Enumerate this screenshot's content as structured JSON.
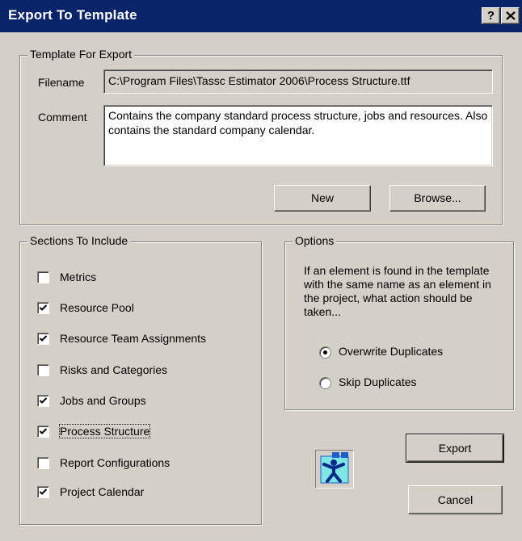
{
  "window": {
    "title": "Export To Template",
    "help_label": "?"
  },
  "template_group": {
    "legend": "Template For Export",
    "filename_label": "Filename",
    "filename_value": "C:\\Program Files\\Tassc Estimator 2006\\Process Structure.ttf",
    "comment_label": "Comment",
    "comment_value": "Contains the company standard process structure, jobs and resources. Also contains the standard company calendar.",
    "new_button": "New",
    "browse_button": "Browse..."
  },
  "sections": {
    "legend": "Sections To Include",
    "items": [
      {
        "label": "Metrics",
        "checked": false
      },
      {
        "label": "Resource Pool",
        "checked": true
      },
      {
        "label": "Resource Team Assignments",
        "checked": true
      },
      {
        "label": "Risks and Categories",
        "checked": false
      },
      {
        "label": "Jobs and Groups",
        "checked": true
      },
      {
        "label": "Process Structure",
        "checked": true
      },
      {
        "label": "Report Configurations",
        "checked": false
      },
      {
        "label": "Project Calendar",
        "checked": true
      }
    ]
  },
  "options": {
    "legend": "Options",
    "description": "If an element is found in the template with the same name as an element in the project, what action should be taken...",
    "radios": [
      {
        "label": "Overwrite Duplicates",
        "selected": true
      },
      {
        "label": "Skip Duplicates",
        "selected": false
      }
    ]
  },
  "actions": {
    "export_button": "Export",
    "cancel_button": "Cancel"
  },
  "icons": {
    "app_icon": "estimator-person-icon",
    "close": "close-icon",
    "check": "check-icon"
  }
}
